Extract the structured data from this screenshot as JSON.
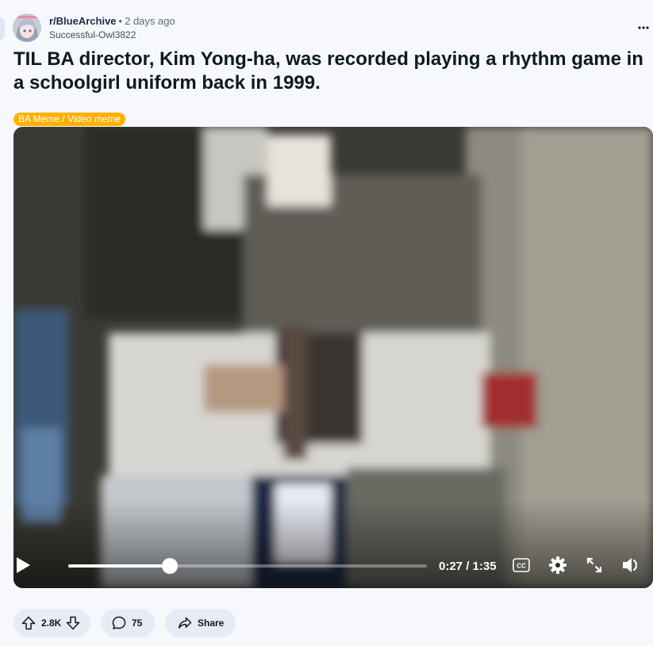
{
  "post": {
    "subreddit": "r/BlueArchive",
    "separator": "•",
    "time_ago": "2 days ago",
    "author": "Successful-Owl3822",
    "more_label": "•••",
    "title": "TIL BA director, Kim Yong-ha, was recorded playing a rhythm game in a schoolgirl uniform back in 1999.",
    "flair": "BA Meme / Video meme",
    "flair_color": "#ffb000"
  },
  "video": {
    "current_time": "0:27",
    "duration": "1:35",
    "time_display": "0:27 / 1:35",
    "progress_fraction": 0.284,
    "cc_label": "CC",
    "icons": [
      "play-icon",
      "closed-captions-icon",
      "gear-icon",
      "expand-icon",
      "volume-icon"
    ]
  },
  "actions": {
    "upvotes": "2.8K",
    "comments": "75",
    "share_label": "Share"
  }
}
